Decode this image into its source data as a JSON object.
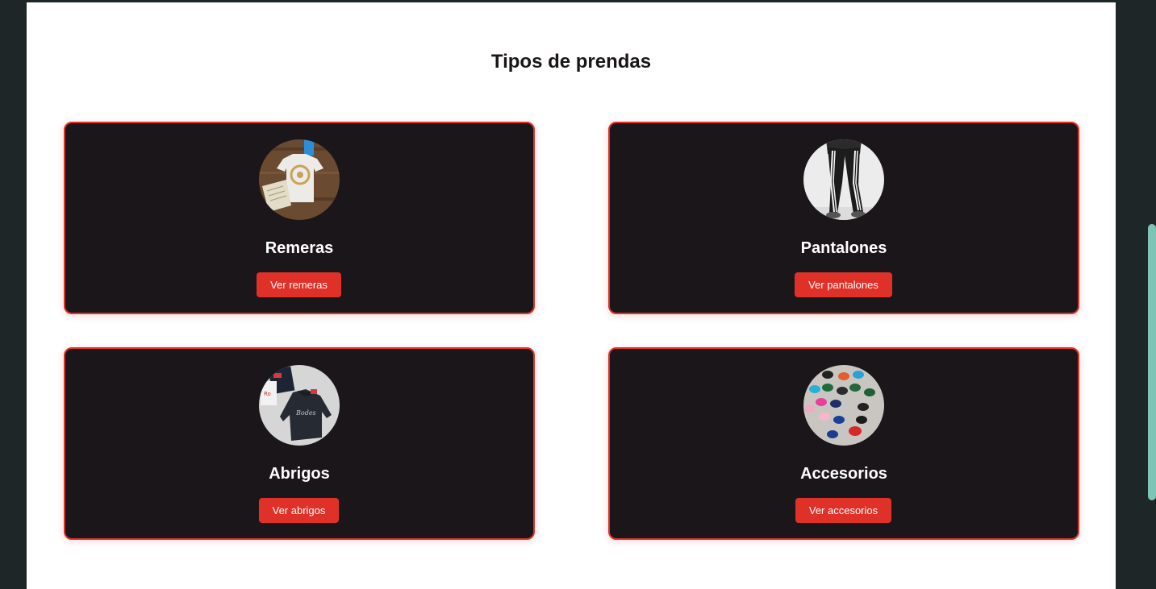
{
  "section": {
    "title": "Tipos de prendas"
  },
  "categories": [
    {
      "title": "Remeras",
      "button_label": "Ver remeras",
      "image": "tshirt-photo"
    },
    {
      "title": "Pantalones",
      "button_label": "Ver pantalones",
      "image": "pants-photo"
    },
    {
      "title": "Abrigos",
      "button_label": "Ver abrigos",
      "image": "hoodie-photo"
    },
    {
      "title": "Accesorios",
      "button_label": "Ver accesorios",
      "image": "caps-photo"
    }
  ],
  "colors": {
    "accent": "#e03128",
    "card_background": "#1a161a",
    "page_background": "#ffffff",
    "outer_background": "#1f2628",
    "scrollbar": "#7cc4b6"
  }
}
